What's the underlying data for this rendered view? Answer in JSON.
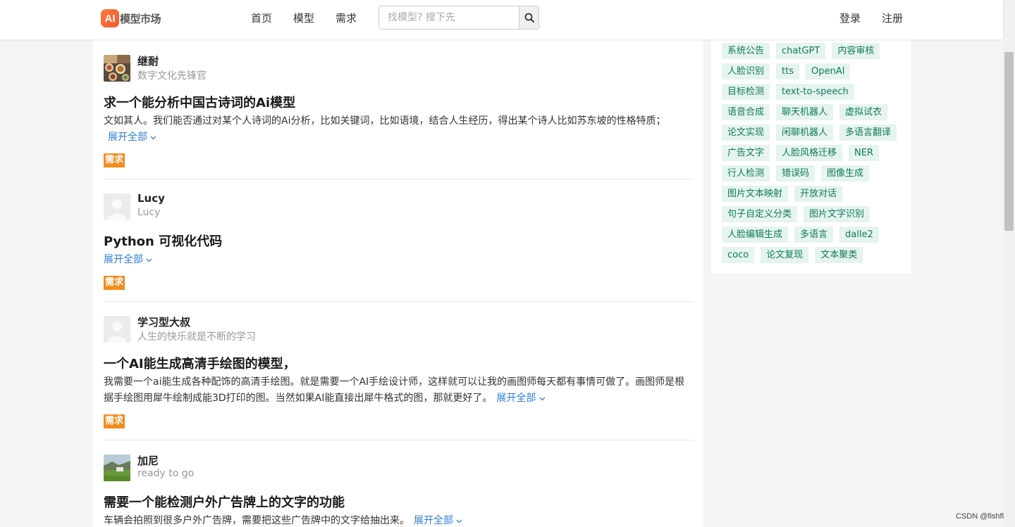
{
  "header": {
    "logo_badge": "AI",
    "logo_text": "模型市场",
    "nav": [
      "首页",
      "模型",
      "需求"
    ],
    "search_placeholder": "找模型? 搜下先",
    "login": "登录",
    "register": "注册"
  },
  "posts": [
    {
      "user": "继耐",
      "signature": "数字文化先锋官",
      "title": "求一个能分析中国古诗词的Ai模型",
      "description": "文如其人。我们能否通过对某个人诗词的Ai分析，比如关键词，比如语境，结合人生经历，得出某个诗人比如苏东坡的性格特质；",
      "expand": "展开全部",
      "badge": "需求"
    },
    {
      "user": "Lucy",
      "signature": "Lucy",
      "title": "Python 可视化代码",
      "description": "",
      "expand": "展开全部",
      "badge": "需求"
    },
    {
      "user": "学习型大叔",
      "signature": "人生的快乐就是不断的学习",
      "title": "一个AI能生成高清手绘图的模型，",
      "description": "我需要一个ai能生成各种配饰的高清手绘图。就是需要一个AI手绘设计师，这样就可以让我的画图师每天都有事情可做了。画图师是根据手绘图用犀牛绘制成能3D打印的图。当然如果AI能直接出犀牛格式的图，那就更好了。",
      "expand": "展开全部",
      "badge": "需求"
    },
    {
      "user": "加尼",
      "signature": "ready to go",
      "title": "需要一个能检测户外广告牌上的文字的功能",
      "description": "车辆会拍照到很多户外广告牌，需要把这些广告牌中的文字给抽出来。",
      "expand": "展开全部",
      "badge": "需求"
    }
  ],
  "sidebar_tags": [
    "系统公告",
    "chatGPT",
    "内容审核",
    "人脸识别",
    "tts",
    "OpenAI",
    "目标检测",
    "text-to-speech",
    "语音合成",
    "聊天机器人",
    "虚拟试衣",
    "论文实现",
    "闲聊机器人",
    "多语言翻译",
    "广告文字",
    "人脸风格迁移",
    "NER",
    "行人检测",
    "错误码",
    "图像生成",
    "图片文本映射",
    "开放对话",
    "句子自定义分类",
    "图片文字识别",
    "人脸编辑生成",
    "多语言",
    "dalle2",
    "coco",
    "论文复现",
    "文本聚类"
  ],
  "watermark": "CSDN @fishfl",
  "colors": {
    "badge": "#f28c1c",
    "link": "#2d7de0",
    "tag_bg": "#e6f4ee",
    "tag_text": "#0e7a5c",
    "logo": "#f25a2e"
  }
}
